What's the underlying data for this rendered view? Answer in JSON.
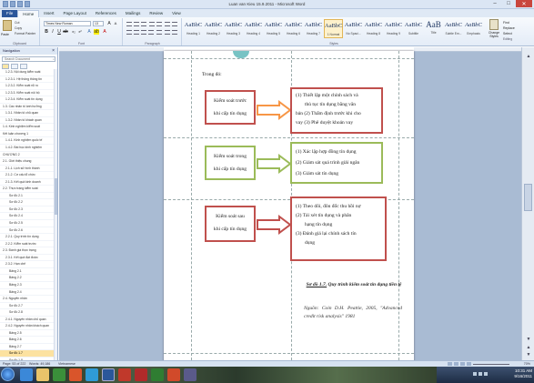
{
  "window": {
    "title": "Luan van Kieu 15.9.2011 - Microsoft Word"
  },
  "tabs": [
    "File",
    "Home",
    "Insert",
    "Page Layout",
    "References",
    "Mailings",
    "Review",
    "View"
  ],
  "clipboard": {
    "paste": "Paste",
    "cut": "Cut",
    "copy": "Copy",
    "format_painter": "Format Painter",
    "label": "Clipboard"
  },
  "font": {
    "name": "Times New Roman",
    "size": "13",
    "label": "Font"
  },
  "paragraph": {
    "label": "Paragraph"
  },
  "styles": {
    "items": [
      {
        "preview": "AaBbC",
        "name": "Heading 1"
      },
      {
        "preview": "AaBbC",
        "name": "Heading 2"
      },
      {
        "preview": "AaBbC",
        "name": "Heading 3"
      },
      {
        "preview": "AaBbC",
        "name": "Heading 4"
      },
      {
        "preview": "AaBbC",
        "name": "Heading 5"
      },
      {
        "preview": "AaBbC",
        "name": "Heading 6"
      },
      {
        "preview": "AaBbC",
        "name": "Heading 7"
      },
      {
        "preview": "AaBbC",
        "name": "1 Normal"
      },
      {
        "preview": "AaBbC",
        "name": "No Spaci..."
      },
      {
        "preview": "AaBbC",
        "name": "Heading 8"
      },
      {
        "preview": "AaBbC",
        "name": "Heading 9"
      },
      {
        "preview": "AaBbC",
        "name": "Subtitle"
      },
      {
        "preview": "AaB",
        "name": "Title"
      },
      {
        "preview": "AaBbC",
        "name": "Subtle Em..."
      },
      {
        "preview": "AaBbC",
        "name": "Emphasis"
      }
    ],
    "label": "Styles",
    "change": "Change Styles"
  },
  "editing": {
    "find": "Find",
    "replace": "Replace",
    "select": "Select",
    "label": "Editing"
  },
  "navigation": {
    "title": "Navigation",
    "search_placeholder": "Search Document",
    "items": [
      {
        "label": "1.2.3. Nội dung kiểm soát"
      },
      {
        "label": "1.2.3.1. Hệ thống thông tin"
      },
      {
        "label": "1.2.3.2. Kiểm soát rủi ro"
      },
      {
        "label": "1.2.3.3. Kiểm soát nội bộ"
      },
      {
        "label": "1.2.3.4. Kiểm soát tín dụng"
      },
      {
        "label": "1.3. Các nhân tố ảnh hưởng"
      },
      {
        "label": "1.3.1. Nhân tố chủ quan"
      },
      {
        "label": "1.3.2. Nhân tố khách quan"
      },
      {
        "label": "1.4. Kinh nghiệm kiểm soát"
      },
      {
        "label": "Kết luận chương 1"
      },
      {
        "label": "1.4.1. Kinh nghiệm quốc tế"
      },
      {
        "label": "1.4.2. Bài học kinh nghiệm"
      },
      {
        "label": "CHƯƠNG 2"
      },
      {
        "label": "2.1. Giới thiệu chung"
      },
      {
        "label": "2.1.1. Lịch sử hình thành"
      },
      {
        "label": "2.1.2. Cơ cấu tổ chức"
      },
      {
        "label": "2.1.3. Kết quả kinh doanh"
      },
      {
        "label": "2.2. Thực trạng kiểm soát"
      },
      {
        "label": "Sơ đồ 2.1"
      },
      {
        "label": "Sơ đồ 2.2"
      },
      {
        "label": "Sơ đồ 2.3"
      },
      {
        "label": "Sơ đồ 2.4"
      },
      {
        "label": "Sơ đồ 2.5"
      },
      {
        "label": "Sơ đồ 2.6"
      },
      {
        "label": "2.2.1. Quy trình tín dụng"
      },
      {
        "label": "2.2.2. Kiểm soát trước"
      },
      {
        "label": "2.3. Đánh giá thực trạng"
      },
      {
        "label": "2.3.1. Kết quả đạt được"
      },
      {
        "label": "2.3.2. Hạn chế"
      },
      {
        "label": "Bảng 2.1"
      },
      {
        "label": "Bảng 2.2"
      },
      {
        "label": "Bảng 2.3"
      },
      {
        "label": "Bảng 2.4"
      },
      {
        "label": "2.4. Nguyên nhân"
      },
      {
        "label": "Sơ đồ 2.7"
      },
      {
        "label": "Sơ đồ 2.8"
      },
      {
        "label": "2.4.1. Nguyên nhân chủ quan"
      },
      {
        "label": "2.4.2. Nguyên nhân khách quan"
      },
      {
        "label": "Bảng 2.5"
      },
      {
        "label": "Bảng 2.6"
      },
      {
        "label": "Bảng 2.7"
      },
      {
        "label": "Sơ đồ 1.7",
        "selected": true
      },
      {
        "label": "Sơ đồ 1.8"
      }
    ]
  },
  "document": {
    "intro": "Trong đó:",
    "rows": [
      {
        "left": [
          "Kiểm soát trước",
          "khi cấp tín dụng"
        ],
        "right": [
          "(1) Thiết lập một chính sách và",
          "thủ tục tín dụng bằng văn",
          "bản (2) Thẩm định trước khi cho",
          "vay (3) Phê duyệt khoản vay"
        ],
        "color": "#c0504d"
      },
      {
        "left": [
          "Kiểm soát trong",
          "khi cấp tín dụng"
        ],
        "right": [
          "(1) Xác lập hợp đồng tín dụng",
          "(2) Giám sát quá trình giải ngân",
          "(3) Giám sát tín dụng"
        ],
        "color": "#9bbb59"
      },
      {
        "left": [
          "Kiểm soát sau",
          "khi cấp tín dụng"
        ],
        "right": [
          "(1) Theo dõi, đôn đốc thu hồi nợ",
          "(2) Tái xét tín dụng và phân",
          "hạng tín dụng",
          "(3) Đánh giá lại chính sách tín",
          "dụng"
        ],
        "color": "#c0504d"
      }
    ],
    "caption_prefix": "Sơ đồ 1.7.",
    "caption": "Quy trình kiểm soát tín dụng tiền tệ",
    "source": "Nguồn: Coin D.H. Peattie, 2005, \"Advanced credit risk analysis\" 1981"
  },
  "status": {
    "page": "Page: 53 of 222",
    "words": "Words: 49,186",
    "language": "Vietnamese",
    "zoom": "70%"
  },
  "clock": {
    "time": "10:31 AM",
    "date": "9/16/2011"
  }
}
